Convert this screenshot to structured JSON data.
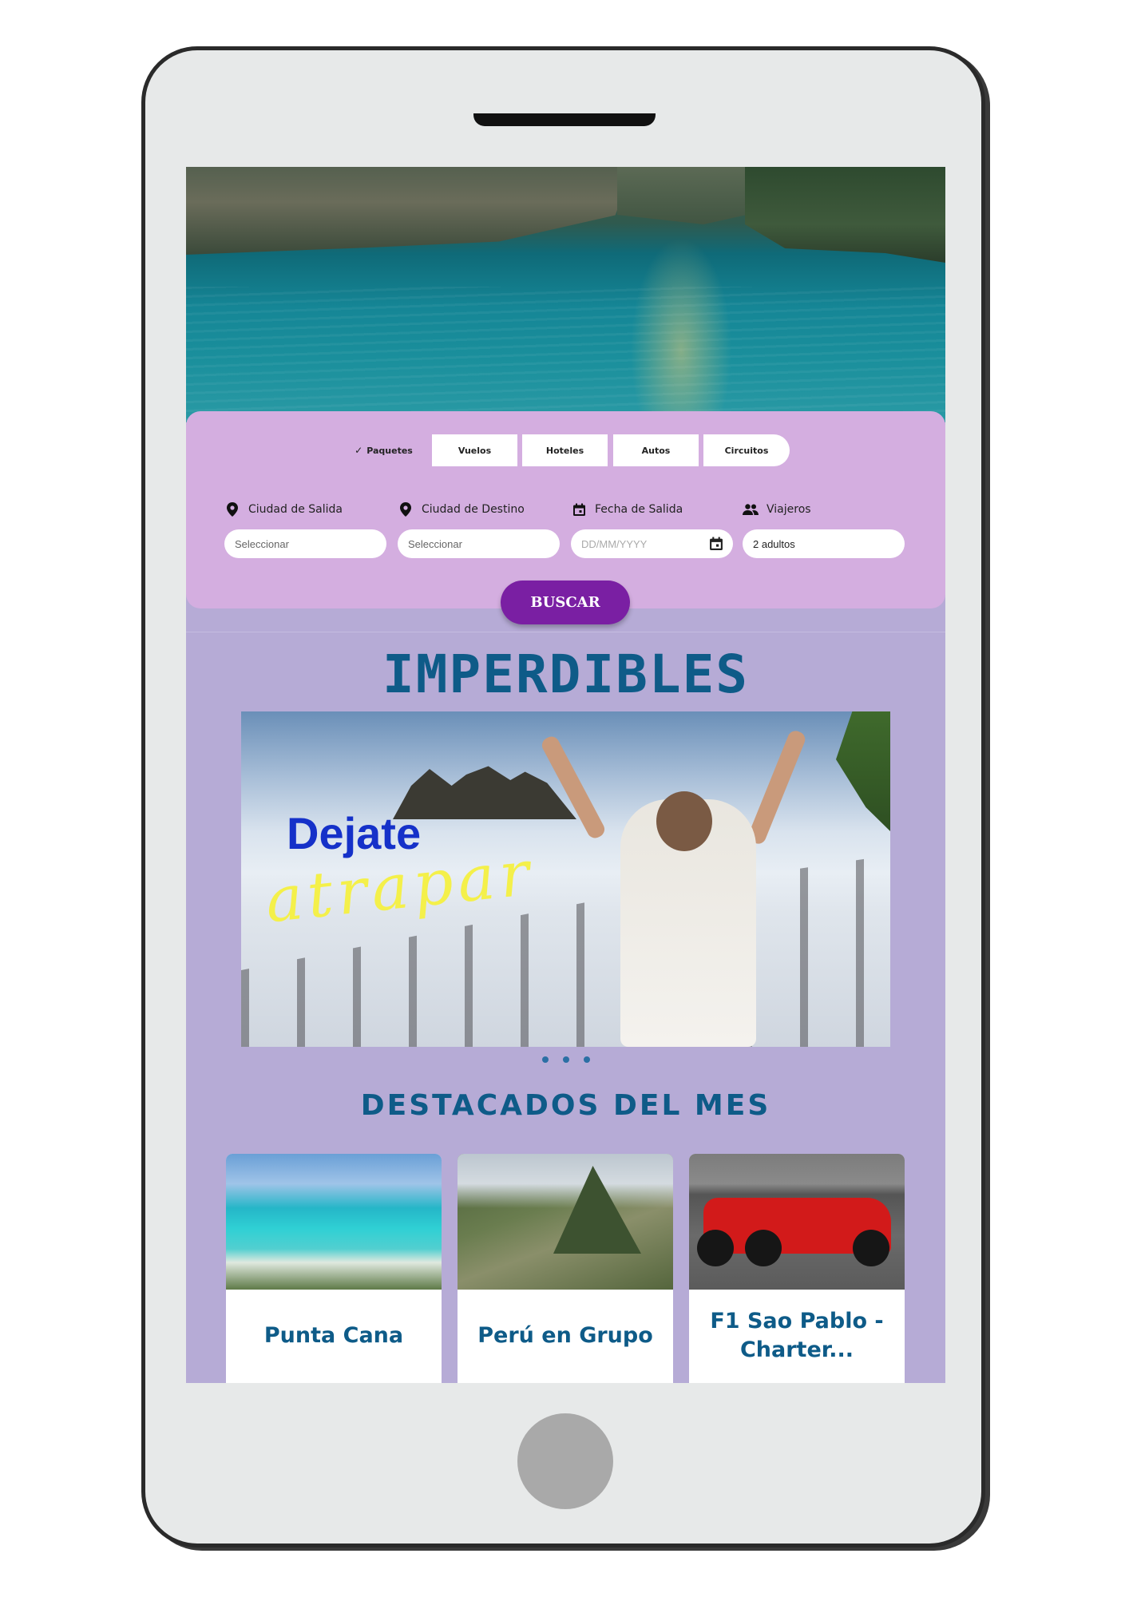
{
  "tabs": [
    {
      "label": "Paquetes",
      "active": true
    },
    {
      "label": "Vuelos",
      "active": false
    },
    {
      "label": "Hoteles",
      "active": false
    },
    {
      "label": "Autos",
      "active": false
    },
    {
      "label": "Circuitos",
      "active": false
    }
  ],
  "search": {
    "fields": [
      {
        "label": "Ciudad de Salida",
        "icon": "location-pin-icon",
        "value": "Seleccionar"
      },
      {
        "label": "Ciudad de Destino",
        "icon": "location-pin-icon",
        "value": "Seleccionar"
      },
      {
        "label": "Fecha de Salida",
        "icon": "calendar-icon",
        "placeholder": "DD/MM/YYYY"
      },
      {
        "label": "Viajeros",
        "icon": "people-icon",
        "value": "2 adultos"
      }
    ],
    "button_label": "BUSCAR"
  },
  "imperdibles": {
    "title": "IMPERDIBLES",
    "banner": {
      "title": "Dejate",
      "subtitle": "atrapar"
    },
    "carousel": {
      "total": 3,
      "active_index": 2
    }
  },
  "destacados": {
    "title": "DESTACADOS DEL MES",
    "cards": [
      {
        "title": "Punta Cana"
      },
      {
        "title": "Perú en Grupo"
      },
      {
        "title": "F1 Sao Pablo - Charter..."
      }
    ]
  },
  "colors": {
    "panel": "#d4aee0",
    "page_background": "#b6abd6",
    "button": "#7a1fa3",
    "heading": "#0e5b88"
  }
}
